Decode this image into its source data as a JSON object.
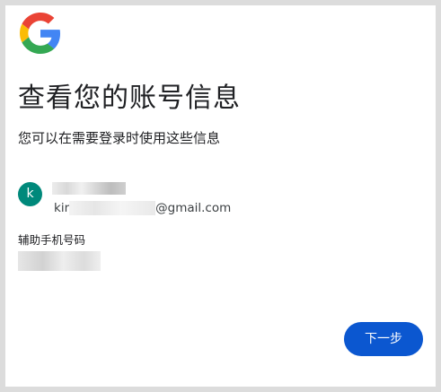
{
  "brand": {
    "logo": "google-g-logo",
    "colors": {
      "blue": "#4285F4",
      "red": "#EA4335",
      "yellow": "#FBBC05",
      "green": "#34A853"
    }
  },
  "title": "查看您的账号信息",
  "subtitle": "您可以在需要登录时使用这些信息",
  "account": {
    "avatar_letter": "k",
    "avatar_color": "#00897b",
    "email_prefix": "kir",
    "email_suffix": "@gmail.com"
  },
  "phone_label": "辅助手机号码",
  "next_button": {
    "label": "下一步",
    "color": "#0b57d0"
  }
}
